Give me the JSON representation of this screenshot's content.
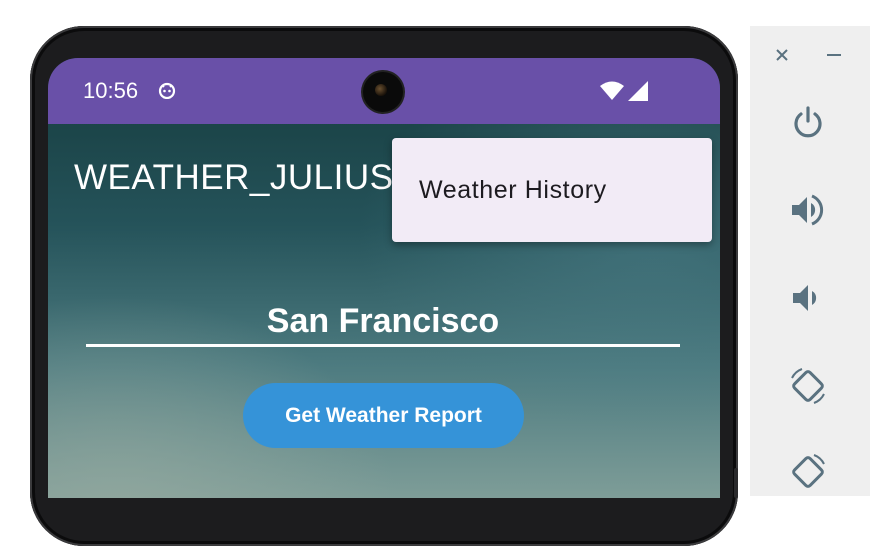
{
  "status_bar": {
    "time": "10:56",
    "notification_icon": "android-debug-icon",
    "wifi_icon": "wifi-icon",
    "signal_icon": "cell-signal-icon",
    "background_color": "#6950a8"
  },
  "app": {
    "title": "WEATHER_JULIUS",
    "overflow_menu": {
      "items": [
        {
          "label": "Weather History"
        }
      ]
    },
    "city_input": {
      "value": "San Francisco"
    },
    "get_report_button": {
      "label": "Get Weather Report",
      "color": "#3593d8"
    }
  },
  "emulator_controls": {
    "close": "close-icon",
    "minimize": "minimize-icon",
    "buttons": [
      {
        "icon": "power-icon"
      },
      {
        "icon": "volume-up-icon"
      },
      {
        "icon": "volume-down-icon"
      },
      {
        "icon": "rotate-left-icon"
      },
      {
        "icon": "rotate-right-icon"
      }
    ]
  }
}
